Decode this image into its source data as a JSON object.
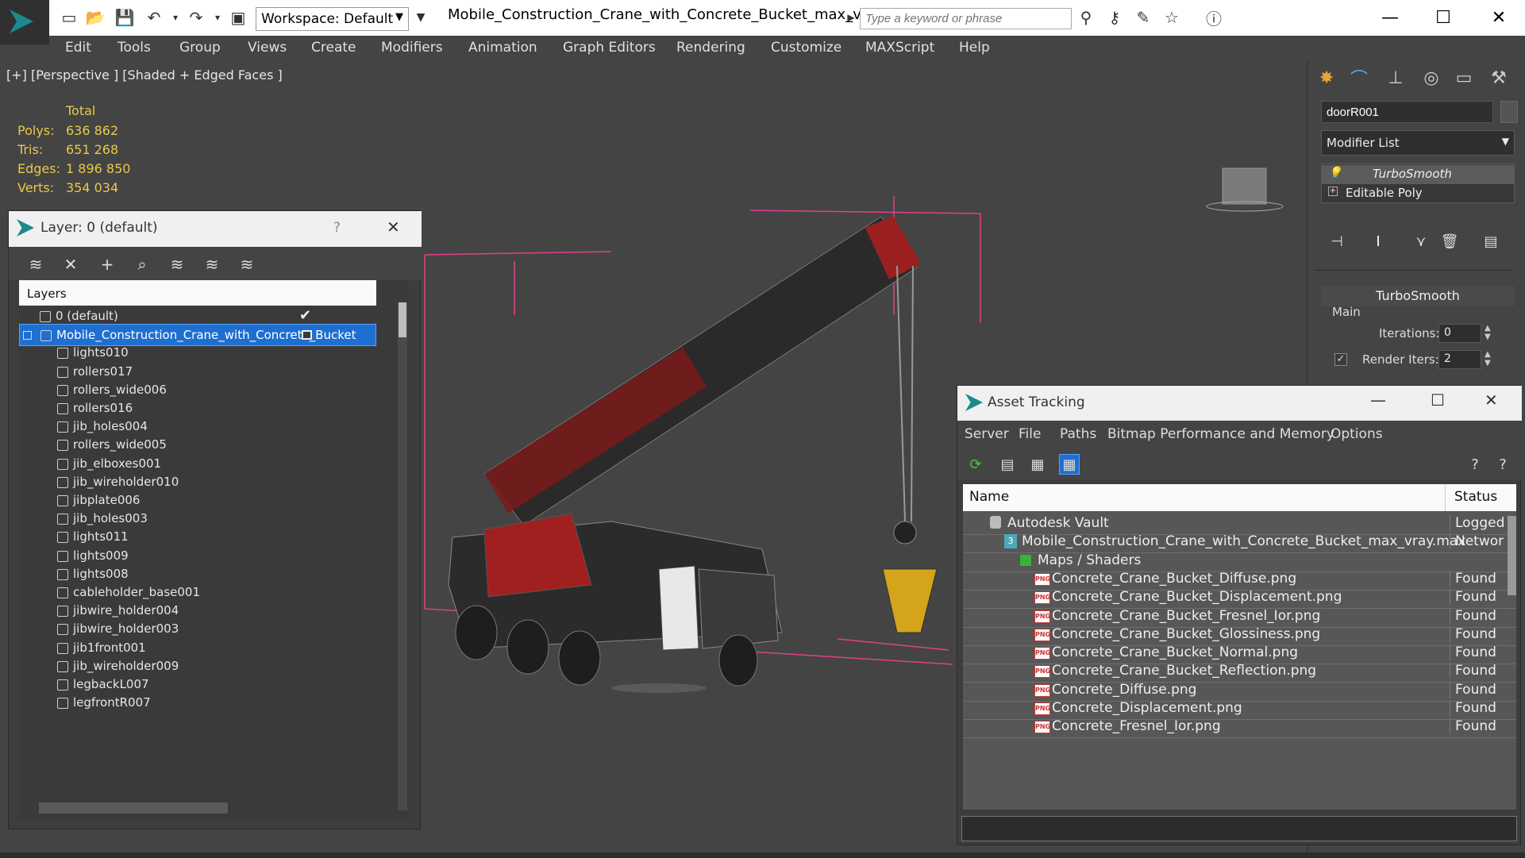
{
  "app": {
    "workspace": "Workspace: Default",
    "document_title": "Mobile_Construction_Crane_with_Concrete_Bucket_max_vra...",
    "search_placeholder": "Type a keyword or phrase"
  },
  "menu": [
    "Edit",
    "Tools",
    "Group",
    "Views",
    "Create",
    "Modifiers",
    "Animation",
    "Graph Editors",
    "Rendering",
    "Customize",
    "MAXScript",
    "Help"
  ],
  "viewport": {
    "label": "[+] [Perspective ] [Shaded + Edged Faces ]",
    "stats_header": "Total",
    "stats": [
      {
        "label": "Polys:",
        "value": "636 862"
      },
      {
        "label": "Tris:",
        "value": "651 268"
      },
      {
        "label": "Edges:",
        "value": "1 896 850"
      },
      {
        "label": "Verts:",
        "value": "354 034"
      }
    ]
  },
  "command_panel": {
    "object_name": "doorR001",
    "modifier_list": "Modifier List",
    "stack": [
      "TurboSmooth",
      "Editable Poly"
    ],
    "rollout_title": "TurboSmooth",
    "group": "Main",
    "iterations_label": "Iterations:",
    "iterations_value": "0",
    "render_iters_label": "Render Iters:",
    "render_iters_value": "2",
    "render_iters_checked": "✓"
  },
  "layer_window": {
    "title": "Layer: 0 (default)",
    "help": "?",
    "header": "Layers",
    "rows": [
      {
        "name": "0 (default)",
        "indent": 0
      },
      {
        "name": "Mobile_Construction_Crane_with_Concrete_Bucket",
        "indent": 0,
        "selected": true
      },
      {
        "name": "lights010",
        "indent": 1
      },
      {
        "name": "rollers017",
        "indent": 1
      },
      {
        "name": "rollers_wide006",
        "indent": 1
      },
      {
        "name": "rollers016",
        "indent": 1
      },
      {
        "name": "jib_holes004",
        "indent": 1
      },
      {
        "name": "rollers_wide005",
        "indent": 1
      },
      {
        "name": "jib_elboxes001",
        "indent": 1
      },
      {
        "name": "jib_wireholder010",
        "indent": 1
      },
      {
        "name": "jibplate006",
        "indent": 1
      },
      {
        "name": "jib_holes003",
        "indent": 1
      },
      {
        "name": "lights011",
        "indent": 1
      },
      {
        "name": "lights009",
        "indent": 1
      },
      {
        "name": "lights008",
        "indent": 1
      },
      {
        "name": "cableholder_base001",
        "indent": 1
      },
      {
        "name": "jibwire_holder004",
        "indent": 1
      },
      {
        "name": "jibwire_holder003",
        "indent": 1
      },
      {
        "name": "jib1front001",
        "indent": 1
      },
      {
        "name": "jib_wireholder009",
        "indent": 1
      },
      {
        "name": "legbackL007",
        "indent": 1
      },
      {
        "name": "legfrontR007",
        "indent": 1
      }
    ]
  },
  "asset_window": {
    "title": "Asset Tracking",
    "menu": [
      "Server",
      "File",
      "Paths",
      "Bitmap Performance and Memory",
      "Options"
    ],
    "columns": {
      "name": "Name",
      "status": "Status"
    },
    "rows": [
      {
        "name": "Autodesk Vault",
        "status": "Logged",
        "level": 0,
        "icon": "vault"
      },
      {
        "name": "Mobile_Construction_Crane_with_Concrete_Bucket_max_vray.max",
        "status": "Networ",
        "level": 1,
        "icon": "max"
      },
      {
        "name": "Maps / Shaders",
        "status": "",
        "level": 2,
        "icon": "maps"
      },
      {
        "name": "Concrete_Crane_Bucket_Diffuse.png",
        "status": "Found",
        "level": 3,
        "icon": "png"
      },
      {
        "name": "Concrete_Crane_Bucket_Displacement.png",
        "status": "Found",
        "level": 3,
        "icon": "png"
      },
      {
        "name": "Concrete_Crane_Bucket_Fresnel_Ior.png",
        "status": "Found",
        "level": 3,
        "icon": "png"
      },
      {
        "name": "Concrete_Crane_Bucket_Glossiness.png",
        "status": "Found",
        "level": 3,
        "icon": "png"
      },
      {
        "name": "Concrete_Crane_Bucket_Normal.png",
        "status": "Found",
        "level": 3,
        "icon": "png"
      },
      {
        "name": "Concrete_Crane_Bucket_Reflection.png",
        "status": "Found",
        "level": 3,
        "icon": "png"
      },
      {
        "name": "Concrete_Diffuse.png",
        "status": "Found",
        "level": 3,
        "icon": "png"
      },
      {
        "name": "Concrete_Displacement.png",
        "status": "Found",
        "level": 3,
        "icon": "png"
      },
      {
        "name": "Concrete_Fresnel_Ior.png",
        "status": "Found",
        "level": 3,
        "icon": "png"
      }
    ]
  },
  "colors": {
    "stats_text": "#e8c94a",
    "selection": "#1f6fd0",
    "bbox": "#e0408a"
  }
}
